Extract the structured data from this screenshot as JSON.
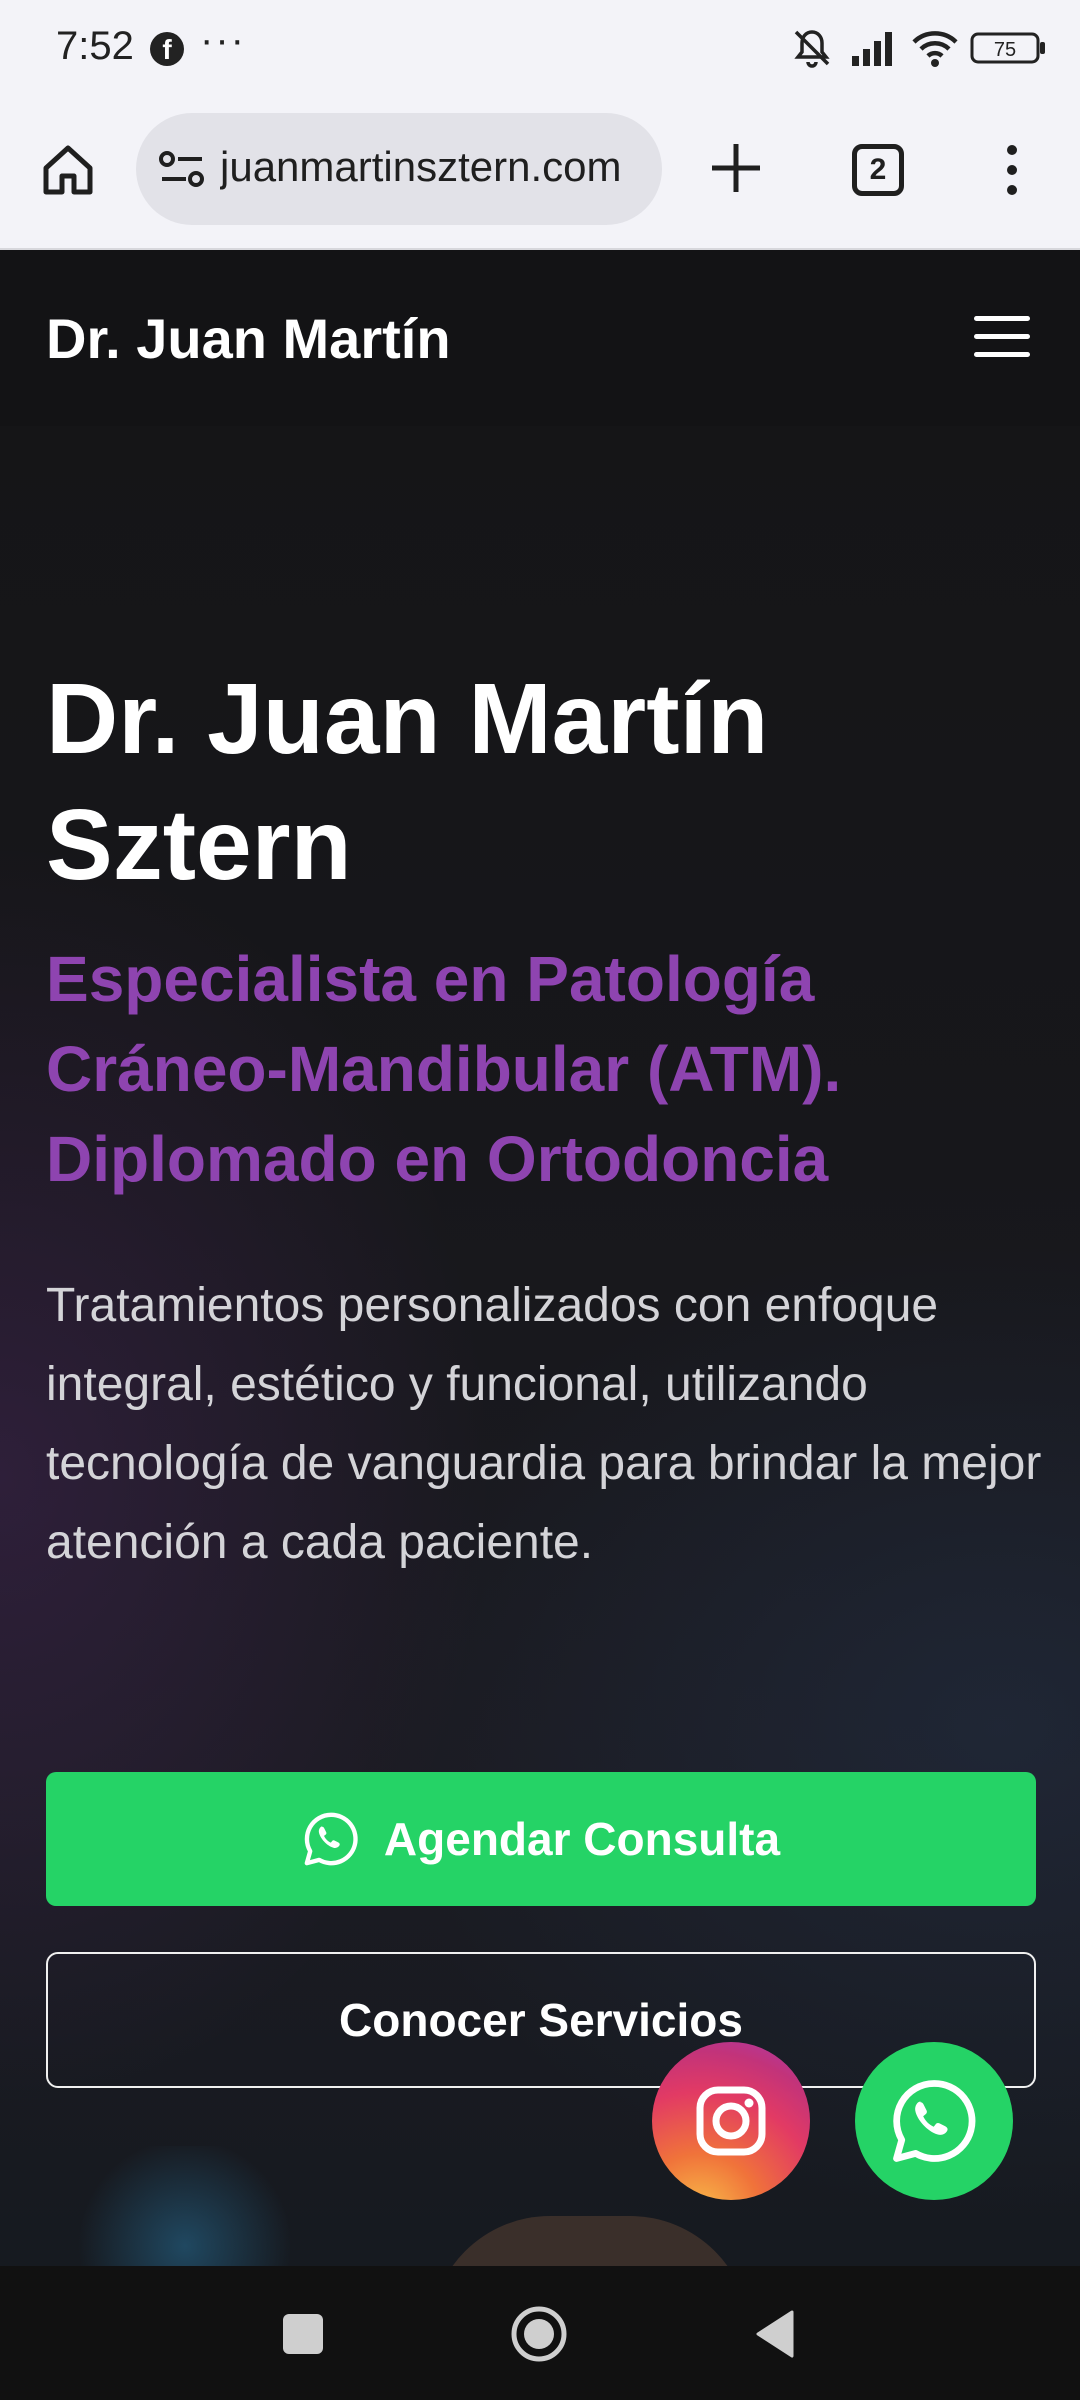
{
  "status_bar": {
    "time": "7:52",
    "facebook_glyph": "f",
    "more": "···",
    "battery": "75"
  },
  "browser": {
    "url": "juanmartinsztern.com",
    "tab_count": "2"
  },
  "site_nav": {
    "brand": "Dr. Juan Martín"
  },
  "hero": {
    "title": "Dr. Juan Martín Sztern",
    "subtitle": "Especialista en Patología Cráneo-Mandibular (ATM). Diplomado en Ortodoncia",
    "description": "Tratamientos personalizados con enfoque integral, estético y funcional, utilizando tecnología de vanguardia para brindar la mejor atención a cada paciente.",
    "primary_button": "Agendar Consulta",
    "secondary_button": "Conocer Servicios"
  },
  "colors": {
    "accent_purple": "#8e44b0",
    "whatsapp_green": "#25d366",
    "background": "#131315"
  },
  "icons": [
    "facebook-icon",
    "mute-icon",
    "signal-icon",
    "wifi-icon",
    "battery-icon",
    "home-icon",
    "site-info-icon",
    "plus-icon",
    "tabs-icon",
    "more-vert-icon",
    "hamburger-menu-icon",
    "whatsapp-icon",
    "instagram-icon",
    "recents-icon",
    "home-circle-icon",
    "back-icon"
  ]
}
